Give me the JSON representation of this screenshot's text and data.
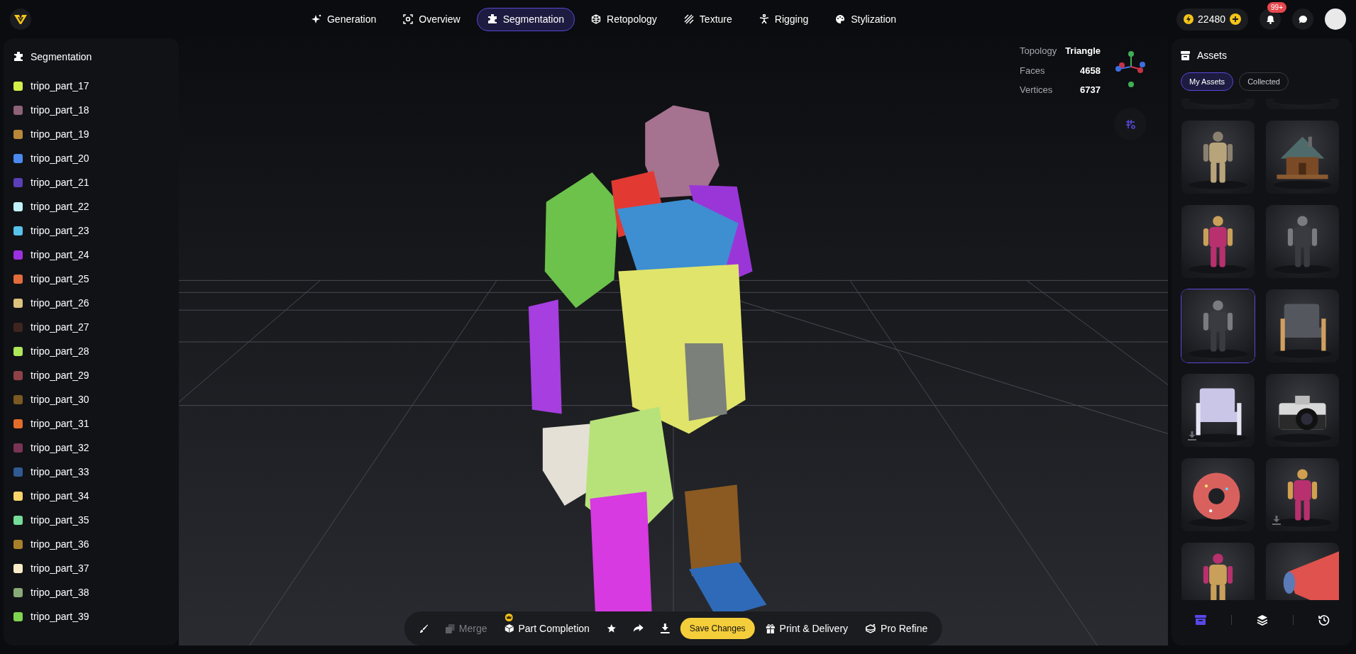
{
  "nav": {
    "tabs": [
      {
        "label": "Generation",
        "selected": false
      },
      {
        "label": "Overview",
        "selected": false
      },
      {
        "label": "Segmentation",
        "selected": true
      },
      {
        "label": "Retopology",
        "selected": false
      },
      {
        "label": "Texture",
        "selected": false
      },
      {
        "label": "Rigging",
        "selected": false
      },
      {
        "label": "Stylization",
        "selected": false
      }
    ],
    "credits": "22480",
    "notifications_badge": "99+"
  },
  "segmentation": {
    "title": "Segmentation",
    "parts": [
      {
        "name": "tripo_part_17",
        "color": "#d4ef4a"
      },
      {
        "name": "tripo_part_18",
        "color": "#8e6278"
      },
      {
        "name": "tripo_part_19",
        "color": "#b98838"
      },
      {
        "name": "tripo_part_20",
        "color": "#4a8af0"
      },
      {
        "name": "tripo_part_21",
        "color": "#5b3fb8"
      },
      {
        "name": "tripo_part_22",
        "color": "#c1f1fb"
      },
      {
        "name": "tripo_part_23",
        "color": "#57c2ea"
      },
      {
        "name": "tripo_part_24",
        "color": "#9d30e0"
      },
      {
        "name": "tripo_part_25",
        "color": "#e46b3b"
      },
      {
        "name": "tripo_part_26",
        "color": "#dcc27a"
      },
      {
        "name": "tripo_part_27",
        "color": "#3f2520"
      },
      {
        "name": "tripo_part_28",
        "color": "#aee85a"
      },
      {
        "name": "tripo_part_29",
        "color": "#8e4247"
      },
      {
        "name": "tripo_part_30",
        "color": "#7a5a22"
      },
      {
        "name": "tripo_part_31",
        "color": "#e46c2a"
      },
      {
        "name": "tripo_part_32",
        "color": "#7a3354"
      },
      {
        "name": "tripo_part_33",
        "color": "#2f5a92"
      },
      {
        "name": "tripo_part_34",
        "color": "#f8d46a"
      },
      {
        "name": "tripo_part_35",
        "color": "#74dc98"
      },
      {
        "name": "tripo_part_36",
        "color": "#a8802a"
      },
      {
        "name": "tripo_part_37",
        "color": "#f8ecc8"
      },
      {
        "name": "tripo_part_38",
        "color": "#88aa78"
      },
      {
        "name": "tripo_part_39",
        "color": "#7fd450"
      }
    ]
  },
  "viewport": {
    "stats": [
      {
        "label": "Topology",
        "value": "Triangle"
      },
      {
        "label": "Faces",
        "value": "4658"
      },
      {
        "label": "Vertices",
        "value": "6737"
      }
    ]
  },
  "toolbar": {
    "items": [
      {
        "kind": "icon"
      },
      {
        "kind": "button",
        "label": "Merge",
        "disabled": true
      },
      {
        "kind": "button",
        "label": "Part Completion",
        "premium": true
      },
      {
        "kind": "icon"
      },
      {
        "kind": "icon"
      },
      {
        "kind": "icon"
      },
      {
        "kind": "primary",
        "label": "Save Changes"
      },
      {
        "kind": "button",
        "label": "Print & Delivery"
      },
      {
        "kind": "button",
        "label": "Pro Refine"
      }
    ]
  },
  "assets": {
    "title": "Assets",
    "tabs": [
      {
        "label": "My Assets",
        "selected": true
      },
      {
        "label": "Collected",
        "selected": false
      }
    ],
    "items": [
      {
        "kind": "picture",
        "selected": false
      },
      {
        "kind": "picture",
        "selected": false
      },
      {
        "kind": "picture",
        "selected": false
      },
      {
        "kind": "picture",
        "selected": false
      },
      {
        "kind": "picture",
        "selected": false
      },
      {
        "kind": "picture",
        "selected": false
      },
      {
        "kind": "picture",
        "selected": true
      },
      {
        "kind": "picture",
        "selected": false
      },
      {
        "kind": "picture",
        "selected": false,
        "download": true
      },
      {
        "kind": "picture",
        "selected": false
      },
      {
        "kind": "picture",
        "selected": false
      },
      {
        "kind": "picture",
        "selected": false,
        "download": true
      },
      {
        "kind": "picture",
        "selected": false
      },
      {
        "kind": "picture",
        "selected": false
      }
    ],
    "bottom_tabs": [
      {
        "selected": true
      },
      {
        "selected": false
      },
      {
        "selected": false
      }
    ]
  }
}
